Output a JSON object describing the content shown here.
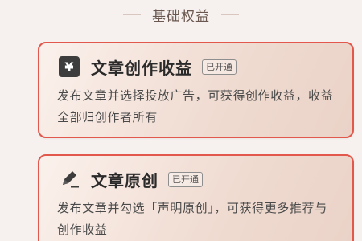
{
  "section": {
    "title": "基础权益"
  },
  "cards": [
    {
      "icon": "yen-icon",
      "symbol": "¥",
      "title": "文章创作收益",
      "badge": "已开通",
      "description": "发布文章并选择投放广告，可获得创作收益，收益全部归创作者所有"
    },
    {
      "icon": "pen-icon",
      "title": "文章原创",
      "badge": "已开通",
      "description": "发布文章并勾选「声明原创」，可获得更多推荐与创作收益"
    }
  ],
  "colors": {
    "accent_border": "#e2584c",
    "background": "#f6f1ee"
  }
}
